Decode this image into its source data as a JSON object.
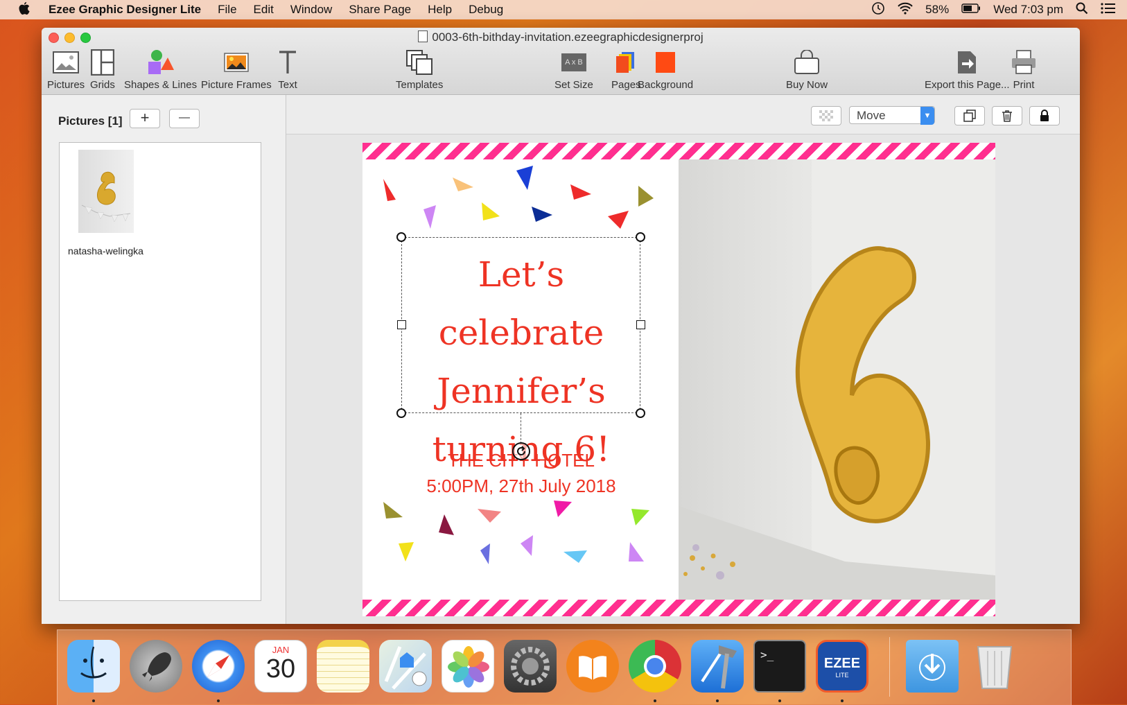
{
  "menubar": {
    "app_name": "Ezee Graphic Designer Lite",
    "menus": [
      "File",
      "Edit",
      "Window",
      "Share Page",
      "Help",
      "Debug"
    ],
    "battery": "58%",
    "clock": "Wed 7:03 pm"
  },
  "window": {
    "title": "0003-6th-bithday-invitation.ezeegraphicdesignerproj"
  },
  "toolbar": {
    "pictures": "Pictures",
    "grids": "Grids",
    "shapes": "Shapes & Lines",
    "frames": "Picture Frames",
    "text": "Text",
    "templates": "Templates",
    "set_size": "Set Size",
    "set_size_icon_text": "A x B",
    "pages": "Pages",
    "background": "Background",
    "buy_now": "Buy Now",
    "export": "Export this Page...",
    "print": "Print"
  },
  "left_panel": {
    "title": "Pictures [1]",
    "add": "+",
    "remove": "—",
    "items": [
      {
        "caption": "natasha-welingka"
      }
    ]
  },
  "subtoolbar": {
    "mode": "Move"
  },
  "canvas": {
    "headline": [
      "Let’s celebrate",
      "Jennifer’s",
      "turning 6!"
    ],
    "venue": "THE CITY HOTEL",
    "datetime": "5:00PM, 27th July 2018",
    "colors": {
      "text": "#ee3324",
      "stripe": "#ff2f8f",
      "balloon": "#e8b53a"
    }
  },
  "dock": {
    "calendar_month": "JAN",
    "calendar_day": "30",
    "terminal_prompt": ">_",
    "ezee_label": "EZEE",
    "ezee_sub": "LITE"
  }
}
